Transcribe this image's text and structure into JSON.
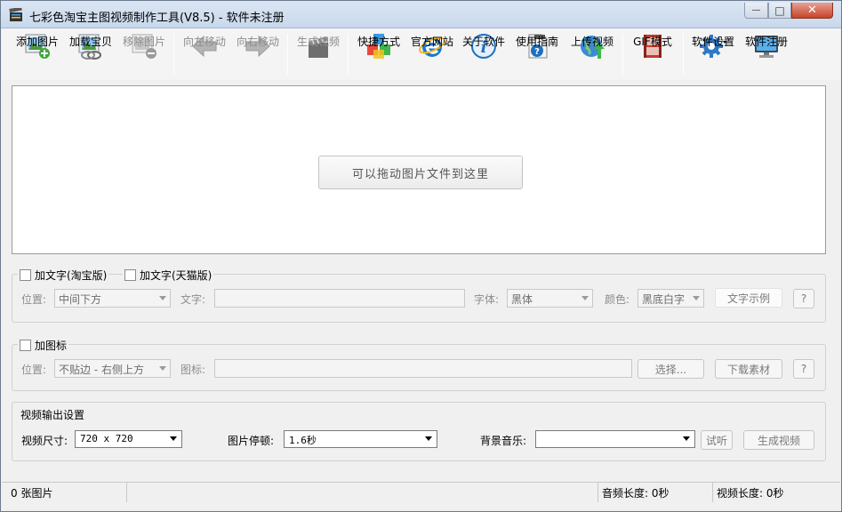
{
  "window": {
    "title": "七彩色淘宝主图视频制作工具(V8.5) - 软件未注册",
    "controls": {
      "minimize": "—",
      "maximize": "□",
      "close": "✕"
    }
  },
  "toolbar": {
    "items": [
      {
        "label": "添加图片",
        "icon": "add-image-icon",
        "enabled": true
      },
      {
        "label": "加载宝贝",
        "icon": "load-item-icon",
        "enabled": true
      },
      {
        "label": "移除图片",
        "icon": "remove-image-icon",
        "enabled": false
      },
      {
        "label": "向左移动",
        "icon": "arrow-left-icon",
        "enabled": false
      },
      {
        "label": "向右移动",
        "icon": "arrow-right-icon",
        "enabled": false
      },
      {
        "label": "生成视频",
        "icon": "clapperboard-icon",
        "enabled": false
      },
      {
        "label": "快捷方式",
        "icon": "shortcut-cubes-icon",
        "enabled": true
      },
      {
        "label": "官方网站",
        "icon": "ie-icon",
        "enabled": true
      },
      {
        "label": "关于软件",
        "icon": "info-icon",
        "enabled": true
      },
      {
        "label": "使用指南",
        "icon": "help-doc-icon",
        "enabled": true
      },
      {
        "label": "上传视频",
        "icon": "globe-upload-icon",
        "enabled": true
      },
      {
        "label": "GIF模式",
        "icon": "gif-film-icon",
        "enabled": true
      },
      {
        "label": "软件设置",
        "icon": "gear-icon",
        "enabled": true
      },
      {
        "label": "软件注册",
        "icon": "monitor-icon",
        "enabled": true
      }
    ]
  },
  "droparea": {
    "hint": "可以拖动图片文件到这里"
  },
  "text_group": {
    "checkbox_taobao": "加文字(淘宝版)",
    "checkbox_tmall": "加文字(天猫版)",
    "position_label": "位置:",
    "position_value": "中间下方",
    "text_label": "文字:",
    "font_label": "字体:",
    "font_value": "黑体",
    "color_label": "颜色:",
    "color_value": "黑底白字",
    "sample_button": "文字示例",
    "help_button": "?"
  },
  "icon_group": {
    "checkbox": "加图标",
    "position_label": "位置:",
    "position_value": "不贴边 - 右侧上方",
    "icon_label": "图标:",
    "browse_button": "选择...",
    "download_button": "下载素材",
    "help_button": "?"
  },
  "output_group": {
    "title": "视频输出设置",
    "size_label": "视频尺寸:",
    "size_value": "720 x 720",
    "pause_label": "图片停顿:",
    "pause_value": "1.6秒",
    "music_label": "背景音乐:",
    "music_value": "",
    "listen_button": "试听",
    "generate_button": "生成视频"
  },
  "statusbar": {
    "image_count": "0 张图片",
    "audio_length": "音频长度: 0秒",
    "video_length": "视频长度: 0秒"
  }
}
